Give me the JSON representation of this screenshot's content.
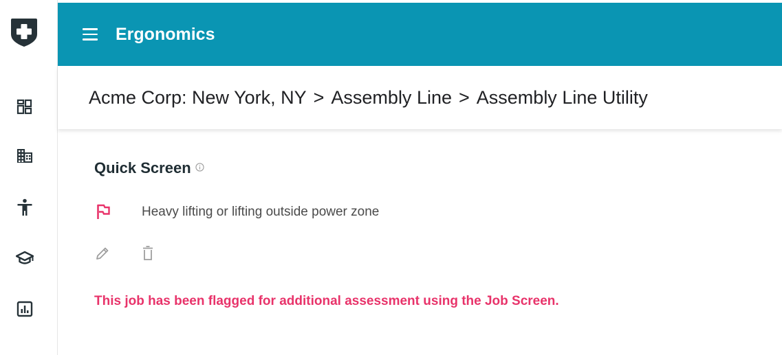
{
  "colors": {
    "header_bg": "#0a95b3",
    "alert": "#e8336a",
    "rail_icon": "#263238",
    "action_icon": "#9e9e9e"
  },
  "header": {
    "title": "Ergonomics",
    "menu_icon": "hamburger-menu-icon"
  },
  "sidebar": {
    "logo_icon": "shield-plus-icon",
    "items": [
      {
        "icon": "dashboard-icon"
      },
      {
        "icon": "building-icon"
      },
      {
        "icon": "accessibility-person-icon"
      },
      {
        "icon": "school-cap-icon"
      },
      {
        "icon": "bar-chart-icon"
      }
    ]
  },
  "breadcrumb": {
    "items": [
      "Acme Corp: New York, NY",
      "Assembly Line",
      "Assembly Line Utility"
    ],
    "separator": ">"
  },
  "quick_screen": {
    "title": "Quick Screen",
    "info_icon": "info-icon",
    "flag_icon": "flag-icon",
    "flag_text": "Heavy lifting or lifting outside power zone",
    "edit_icon": "pencil-icon",
    "delete_icon": "trash-icon",
    "message": "This job has been flagged for additional assessment using the Job Screen."
  }
}
